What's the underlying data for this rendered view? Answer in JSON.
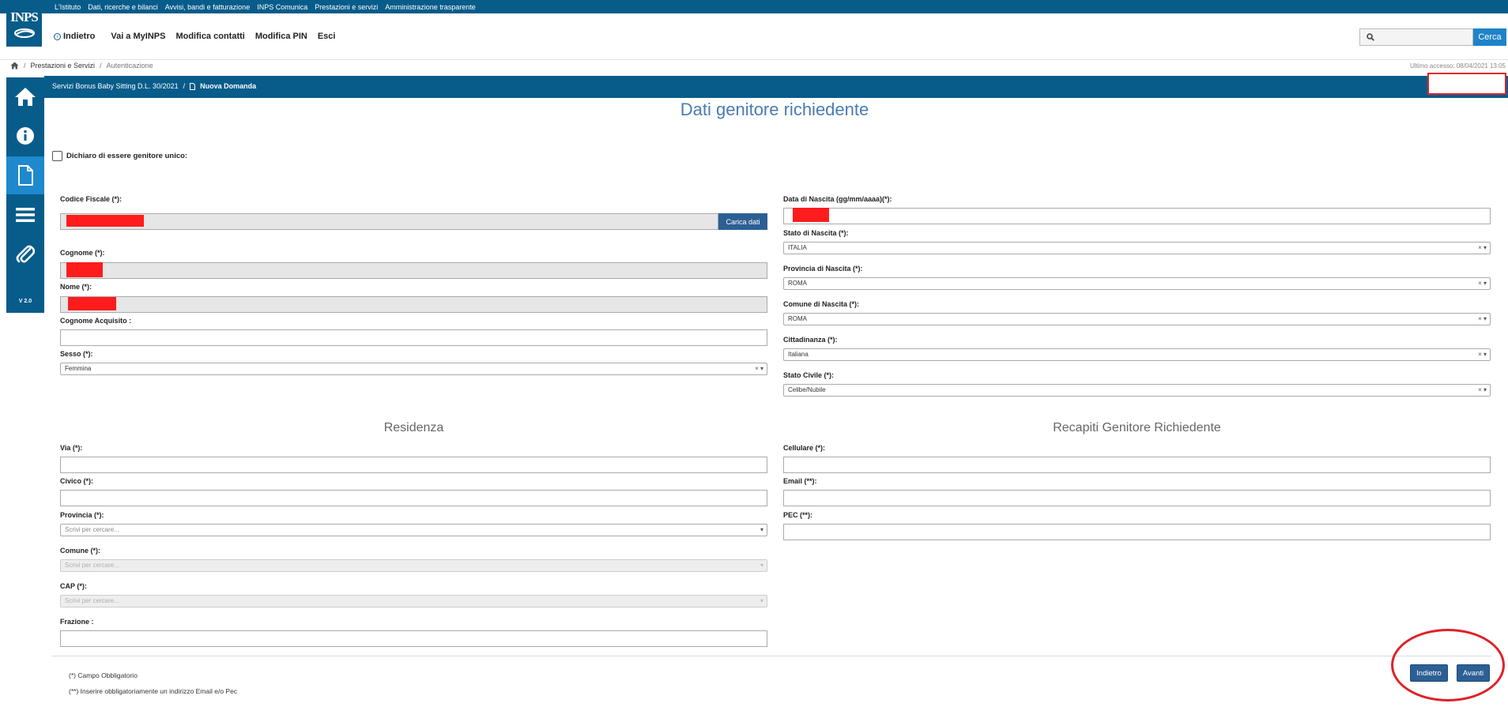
{
  "topbar": {
    "links": [
      "L'Istituto",
      "Dati, ricerche e bilanci",
      "Avvisi, bandi e fatturazione",
      "INPS Comunica",
      "Prestazioni e servizi",
      "Amministrazione trasparente"
    ]
  },
  "logo": {
    "text": "INPS"
  },
  "nav": {
    "back": "Indietro",
    "items": [
      "Vai a MyINPS",
      "Modifica contatti",
      "Modifica PIN",
      "Esci"
    ]
  },
  "search": {
    "button": "Cerca",
    "value": ""
  },
  "breadcrumb": {
    "sep": "/",
    "link": "Prestazioni e Servizi",
    "current": "Autenticazione"
  },
  "last_access": "Ultimo accesso: 08/04/2021 13:05",
  "sidebar": {
    "version": "V 2.0",
    "icons": [
      "home-icon",
      "info-icon",
      "document-icon",
      "menu-icon",
      "attachment-icon"
    ]
  },
  "band": {
    "service": "Servizi Bonus Baby Sitting D.L. 30/2021",
    "sep": "/",
    "current": "Nuova Domanda"
  },
  "title": "Dati genitore richiedente",
  "single_parent_label": "Dichiaro di essere genitore unico:",
  "left_form": {
    "codice_fiscale": "Codice Fiscale (*):",
    "carica_dati": "Carica dati",
    "cognome": "Cognome (*):",
    "nome": "Nome (*):",
    "cognome_acquisito": "Cognome Acquisito :",
    "sesso": "Sesso (*):",
    "sesso_value": "Femmina"
  },
  "right_form": {
    "data_nascita": "Data di Nascita (gg/mm/aaaa)(*):",
    "stato_nascita": "Stato di Nascita (*):",
    "stato_nascita_value": "ITALIA",
    "provincia_nascita": "Provincia di Nascita (*):",
    "provincia_nascita_value": "ROMA",
    "comune_nascita": "Comune di Nascita (*):",
    "comune_nascita_value": "ROMA",
    "cittadinanza": "Cittadinanza (*):",
    "cittadinanza_value": "Italiana",
    "stato_civile": "Stato Civile (*):",
    "stato_civile_value": "Celibe/Nubile"
  },
  "select_controls": "× ▾",
  "residenza": {
    "title": "Residenza",
    "via": "Via (*):",
    "civico": "Civico (*):",
    "provincia": "Provincia (*):",
    "comune": "Comune (*):",
    "cap": "CAP (*):",
    "frazione": "Frazione :",
    "placeholder": "Scrivi per cercare..."
  },
  "recapiti": {
    "title": "Recapiti Genitore Richiedente",
    "cellulare": "Cellulare (*):",
    "email": "Email (**):",
    "pec": "PEC (**):"
  },
  "notes": [
    "(*) Campo Obbligatorio",
    "(**) Inserire obbligatoriamente un indirizzo Email e/o Pec"
  ],
  "buttons": {
    "indietro": "Indietro",
    "avanti": "Avanti"
  },
  "colors": {
    "brand": "#075c8a",
    "accent": "#1f83c9",
    "button": "#2c5f94",
    "annotation": "#e0202a"
  }
}
